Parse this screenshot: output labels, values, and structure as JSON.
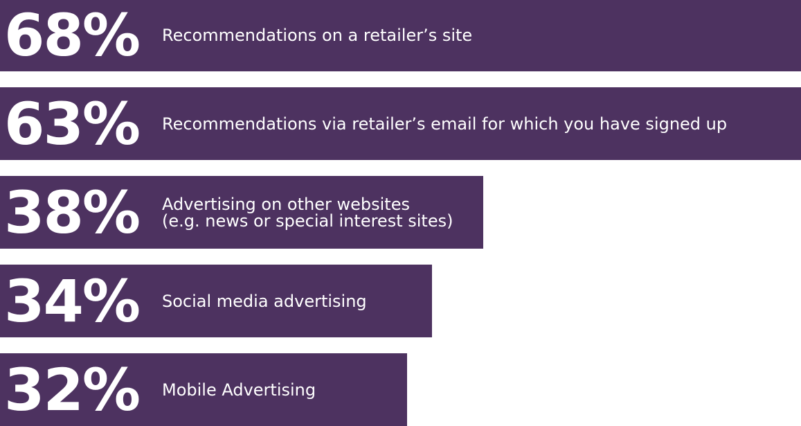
{
  "chart_data": {
    "type": "bar",
    "orientation": "horizontal",
    "color": "#4d3260",
    "categories": [
      "Recommendations on a retailer’s site",
      "Recommendations via retailer’s email for which you have signed up",
      "Advertising on other websites\n(e.g. news or special interest sites)",
      "Social media advertising",
      "Mobile Advertising"
    ],
    "values": [
      68,
      63,
      38,
      34,
      32
    ],
    "value_labels": [
      "68%",
      "63%",
      "38%",
      "34%",
      "32%"
    ],
    "xlim": [
      0,
      68
    ]
  }
}
